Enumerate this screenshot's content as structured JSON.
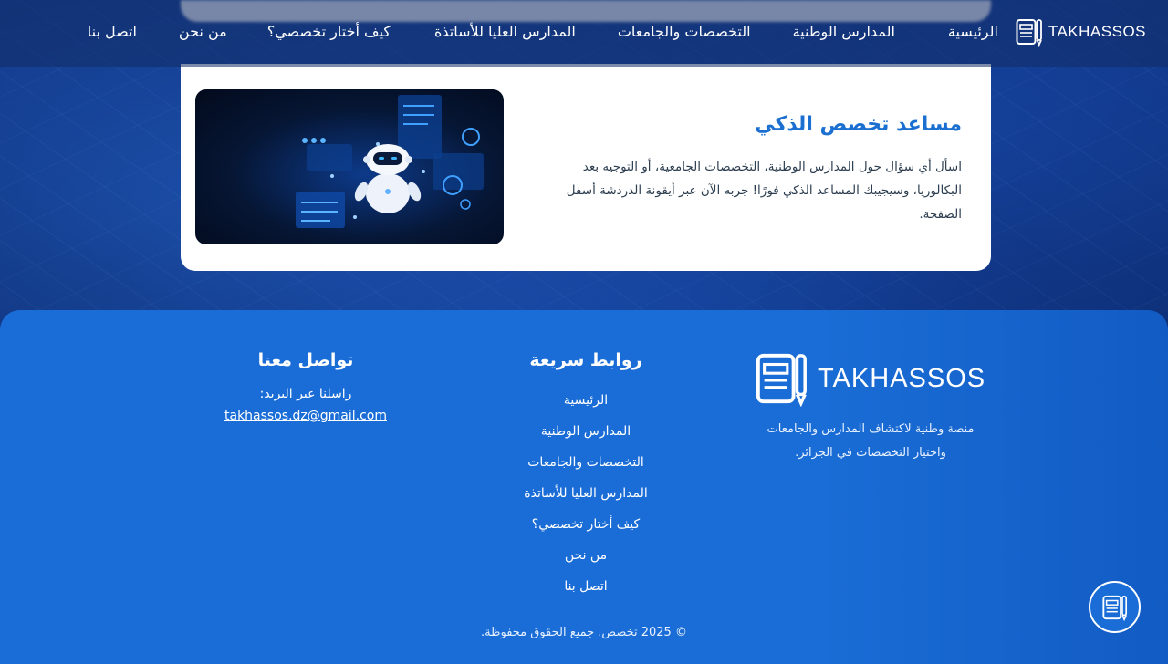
{
  "brand": {
    "name": "TAKHASSOS"
  },
  "nav": {
    "items": [
      "الرئيسية",
      "المدارس الوطنية",
      "التخصصات والجامعات",
      "المدارس العليا للأساتذة",
      "كيف أختار تخصصي؟",
      "من نحن",
      "اتصل بنا"
    ]
  },
  "assistant_card": {
    "title": "مساعد تخصص الذكي",
    "body": "اسأل أي سؤال حول المدارس الوطنية، التخصصات الجامعية، أو التوجيه بعد البكالوريا، وسيجيبك المساعد الذكي فورًا! جربه الآن عبر أيقونة الدردشة أسفل الصفحة."
  },
  "footer": {
    "brand_name": "TAKHASSOS",
    "description_line1": "منصة وطنية لاكتشاف المدارس والجامعات",
    "description_line2": "واختيار التخصصات في الجزائر.",
    "links_title": "روابط سريعة",
    "links": [
      "الرئيسية",
      "المدارس الوطنية",
      "التخصصات والجامعات",
      "المدارس العليا للأساتذة",
      "كيف أختار تخصصي؟",
      "من نحن",
      "اتصل بنا"
    ],
    "contact_title": "تواصل معنا",
    "contact_label": "راسلنا عبر البريد:",
    "email": "takhassos.dz@gmail.com",
    "copyright": "© 2025 تخصص. جميع الحقوق محفوظة."
  },
  "colors": {
    "accent": "#1a6fd0",
    "footer_bg": "#1a6dd6"
  },
  "icons": {
    "logo": "book-logo-icon",
    "chat": "chat-book-icon"
  }
}
